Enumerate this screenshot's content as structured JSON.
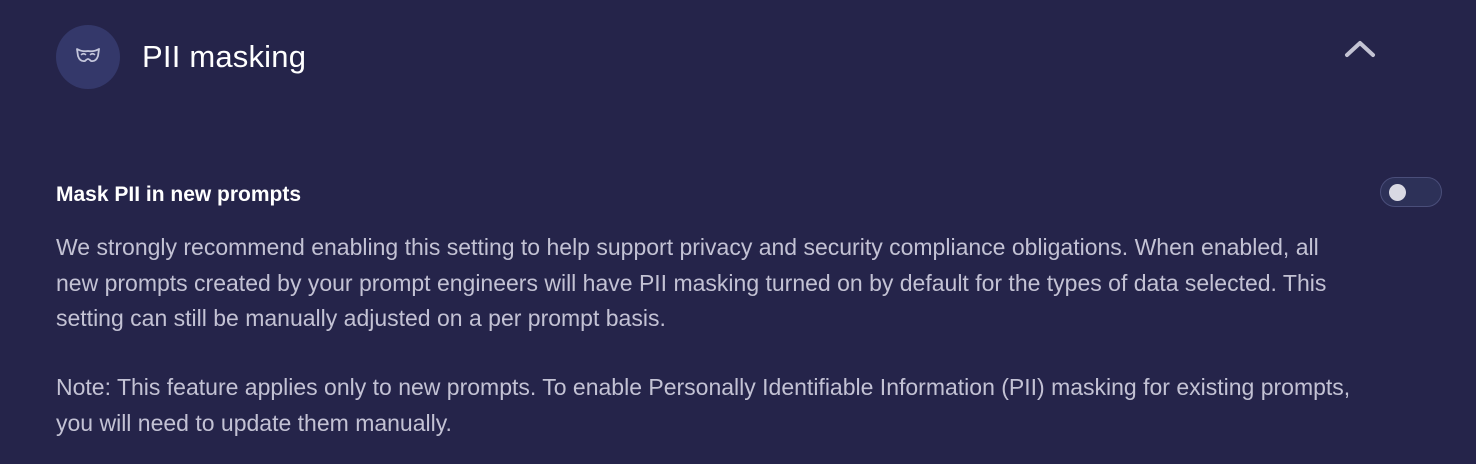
{
  "section": {
    "title": "PII masking",
    "icon": "mask-icon",
    "collapse_icon": "chevron-up-icon"
  },
  "setting": {
    "title": "Mask PII in new prompts",
    "toggle_enabled": false,
    "description": "We strongly recommend enabling this setting to help support privacy and security compliance obligations. When enabled, all new prompts created by your prompt engineers will have PII masking turned on by default for the types of data selected. This setting can still be manually adjusted on a per prompt basis.",
    "note": "Note: This feature applies only to new prompts. To enable Personally Identifiable Information (PII) masking for existing prompts, you will need to update them manually."
  },
  "colors": {
    "background": "#25244a",
    "icon_circle": "#34386a",
    "body_text": "#c3c2d4",
    "title_text": "#ffffff"
  }
}
